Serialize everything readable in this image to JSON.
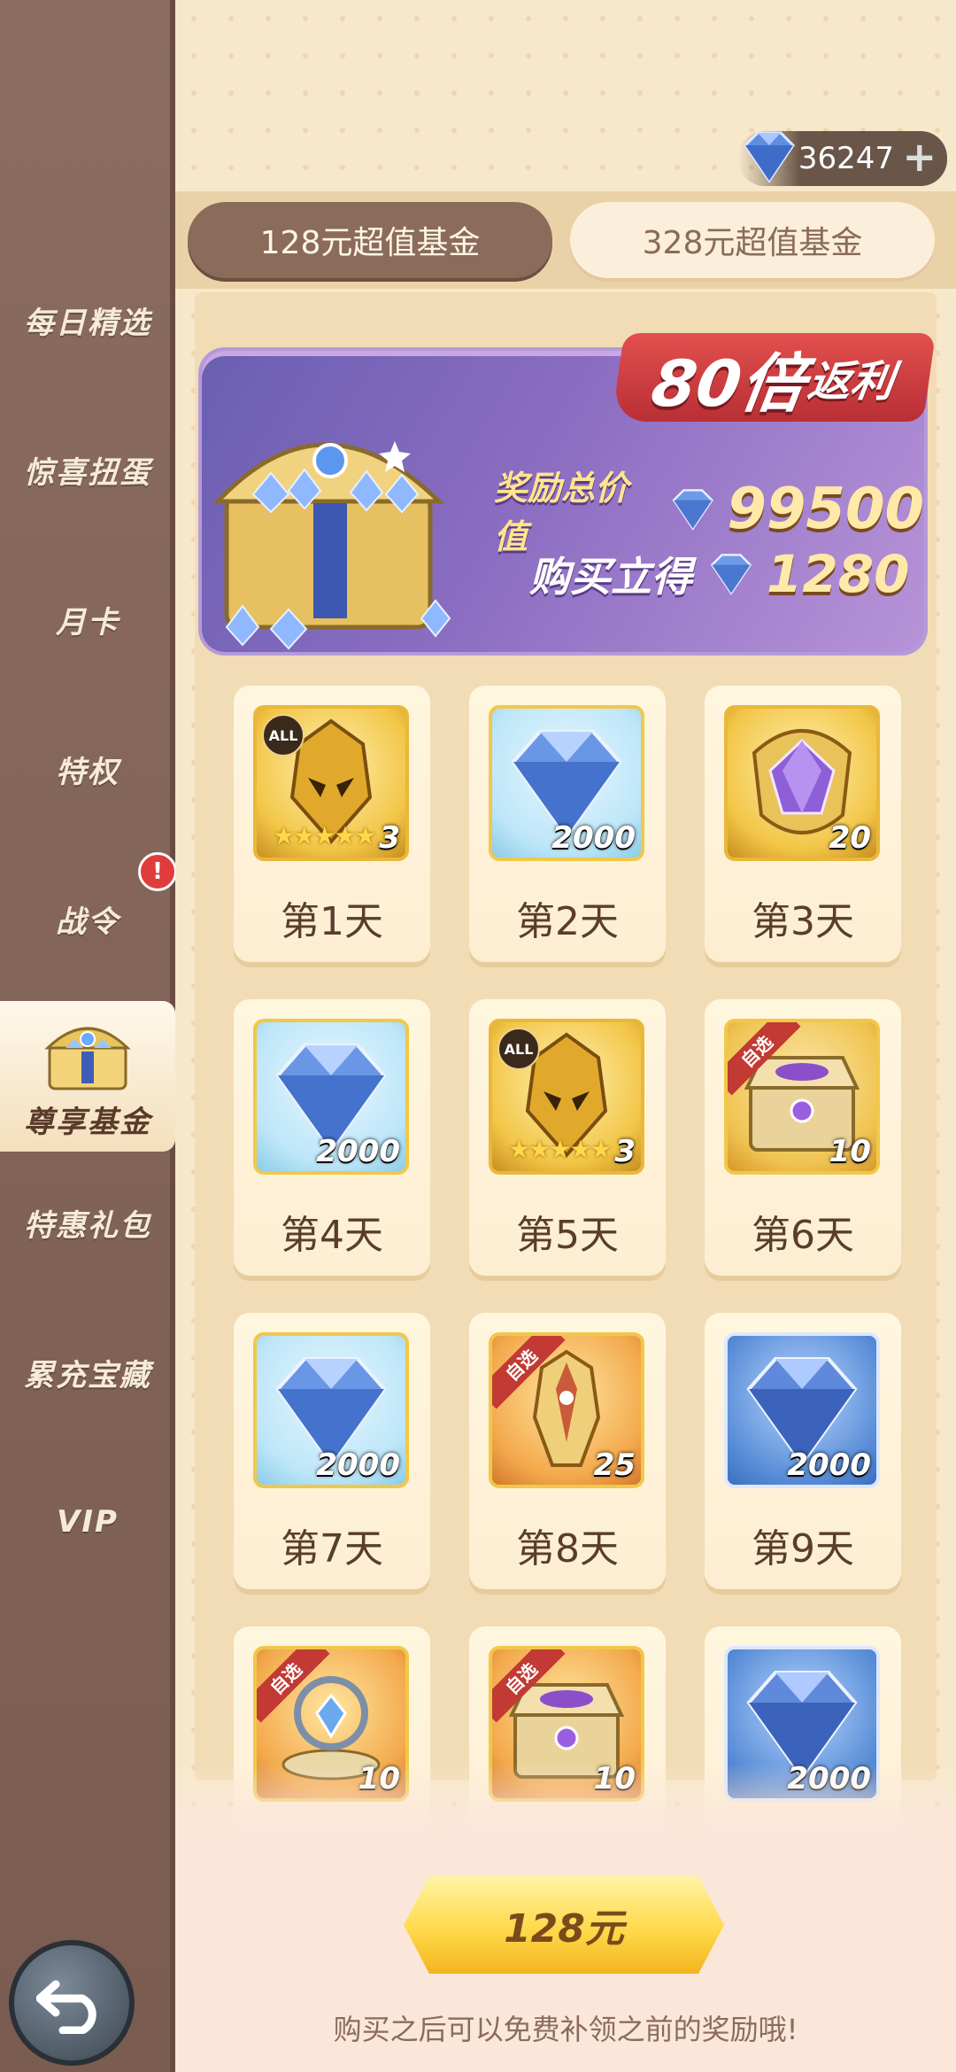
{
  "sidebar": {
    "items": [
      {
        "label": "每日精选"
      },
      {
        "label": "惊喜扭蛋"
      },
      {
        "label": "月卡"
      },
      {
        "label": "特权"
      },
      {
        "label": "战令",
        "badge": "!"
      },
      {
        "label": "尊享基金",
        "active": true
      },
      {
        "label": "特惠礼包"
      },
      {
        "label": "累充宝藏"
      },
      {
        "label": "VIP"
      }
    ]
  },
  "currency": {
    "amount": "36247",
    "icon": "diamond-icon"
  },
  "tabs": [
    {
      "label": "128元超值基金",
      "selected": true
    },
    {
      "label": "328元超值基金",
      "selected": false
    }
  ],
  "banner": {
    "ribbon_big": "80倍",
    "ribbon_small": "返利",
    "total_label": "奖励总价值",
    "total_value": "99500",
    "instant_label": "购买立得",
    "instant_value": "1280"
  },
  "rewards": [
    {
      "day": "第1天",
      "item": "mask-icon",
      "qty": "3",
      "all_tag": "ALL"
    },
    {
      "day": "第2天",
      "item": "diamond-icon",
      "qty": "2000"
    },
    {
      "day": "第3天",
      "item": "crystal-icon",
      "qty": "20"
    },
    {
      "day": "第4天",
      "item": "diamond-icon",
      "qty": "2000"
    },
    {
      "day": "第5天",
      "item": "mask-icon",
      "qty": "3",
      "all_tag": "ALL"
    },
    {
      "day": "第6天",
      "item": "chest-icon",
      "qty": "10",
      "tag": "自选"
    },
    {
      "day": "第7天",
      "item": "diamond-icon",
      "qty": "2000"
    },
    {
      "day": "第8天",
      "item": "armor-icon",
      "qty": "25",
      "tag": "自选"
    },
    {
      "day": "第9天",
      "item": "diamond-icon",
      "qty": "2000"
    },
    {
      "day": "",
      "item": "orb-icon",
      "qty": "10",
      "tag": "自选"
    },
    {
      "day": "",
      "item": "chest-icon",
      "qty": "10",
      "tag": "自选"
    },
    {
      "day": "",
      "item": "diamond-icon",
      "qty": "2000"
    }
  ],
  "buy": {
    "label": "128元",
    "note": "购买之后可以免费补领之前的奖励哦!"
  },
  "colors": {
    "accent": "#ffd94a",
    "sidebar": "#8b6c5f",
    "ribbon": "#e2504d",
    "banner": "#8b6dc1"
  }
}
